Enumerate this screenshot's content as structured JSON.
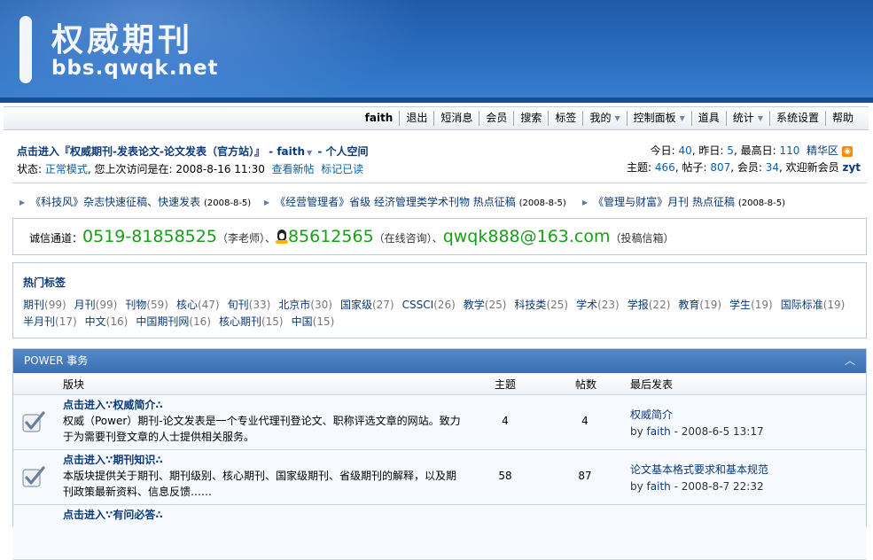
{
  "banner": {
    "title": "权威期刊",
    "url": "bbs.qwqk.net"
  },
  "nav": [
    {
      "label": "faith"
    },
    {
      "label": "退出"
    },
    {
      "label": "短消息"
    },
    {
      "label": "会员"
    },
    {
      "label": "搜索"
    },
    {
      "label": "标签"
    },
    {
      "label": "我的",
      "dropdown": true
    },
    {
      "label": "控制面板",
      "dropdown": true
    },
    {
      "label": "道具"
    },
    {
      "label": "统计",
      "dropdown": true
    },
    {
      "label": "系统设置"
    },
    {
      "label": "帮助"
    }
  ],
  "info": {
    "enter_link": "点击进入『权威期刊-发表论文-论文发表（官方站）』",
    "sep": " - ",
    "user": "faith",
    "space": "- 个人空间",
    "status_label": "状态: ",
    "status_mode": "正常模式",
    "status_text": ", 您上次访问是在: 2008-8-16 11:30",
    "view_new": "查看新帖",
    "mark_read": "标记已读"
  },
  "stats": {
    "today_label": "今日: ",
    "today": "40",
    "yesterday_label": ", 昨日: ",
    "yesterday": "5",
    "max_label": ", 最高日: ",
    "max": "110",
    "digest": "精华区",
    "topics_label": "主题: ",
    "topics": "466",
    "posts_label": ", 帖子: ",
    "posts": "807",
    "members_label": ", 会员: ",
    "members": "34",
    "welcome_label": ", 欢迎新会员 ",
    "newest": "zyt"
  },
  "notices": [
    {
      "text": "《科技风》杂志快速征稿、快速发表",
      "date": "(2008-8-5)"
    },
    {
      "text": "《经营管理者》省级 经济管理类学术刊物 热点征稿",
      "date": "(2008-8-5)"
    },
    {
      "text": "《管理与财富》月刊 热点征稿",
      "date": "(2008-8-5)"
    }
  ],
  "hotline": {
    "label": "诚信通道：",
    "phone": "0519-81858525",
    "phone_note": "（李老师）、",
    "qq": "85612565",
    "qq_note": "（在线咨询）、",
    "email": "qwqk888@163.com",
    "email_note": "（投稿信箱）"
  },
  "tags": {
    "title": "热门标签",
    "row1": [
      {
        "name": "期刊",
        "count": "(99)"
      },
      {
        "name": "月刊",
        "count": "(99)"
      },
      {
        "name": "刊物",
        "count": "(59)"
      },
      {
        "name": "核心",
        "count": "(47)"
      },
      {
        "name": "旬刊",
        "count": "(33)"
      },
      {
        "name": "北京市",
        "count": "(30)"
      },
      {
        "name": "国家级",
        "count": "(27)"
      },
      {
        "name": "CSSCI",
        "count": "(26)"
      },
      {
        "name": "教学",
        "count": "(25)"
      },
      {
        "name": "科技类",
        "count": "(25)"
      },
      {
        "name": "学术",
        "count": "(23)"
      },
      {
        "name": "学报",
        "count": "(22)"
      },
      {
        "name": "教育",
        "count": "(19)"
      },
      {
        "name": "学生",
        "count": "(19)"
      },
      {
        "name": "国际标准",
        "count": "(19)"
      }
    ],
    "row2": [
      {
        "name": "半月刊",
        "count": "(17)"
      },
      {
        "name": "中文",
        "count": "(16)"
      },
      {
        "name": "中国期刊网",
        "count": "(16)"
      },
      {
        "name": "核心期刊",
        "count": "(15)"
      },
      {
        "name": "中国",
        "count": "(15)"
      }
    ]
  },
  "forum": {
    "section_title": "POWER 事务",
    "collapse": "︿",
    "columns": {
      "board": "版块",
      "topics": "主题",
      "posts": "帖数",
      "last": "最后发表"
    },
    "boards": [
      {
        "name": "点击进入∵权威简介∴",
        "desc": "权威（Power）期刊-论文发表是一个专业代理刊登论文、职称评选文章的网站。致力于为需要刊登文章的人士提供相关服务。",
        "topics": "4",
        "posts": "4",
        "last_title": "权威简介",
        "last_by": "by ",
        "last_user": "faith",
        "last_time": " - 2008-6-5 13:17"
      },
      {
        "name": "点击进入∵期刊知识∴",
        "desc": "本版块提供关于期刊、期刊级别、核心期刊、国家级期刊、省级期刊的解释，以及期刊政策最新资料、信息反馈……",
        "topics": "58",
        "posts": "87",
        "last_title": "论文基本格式要求和基本规范",
        "last_by": "by ",
        "last_user": "faith",
        "last_time": " - 2008-8-7 22:32"
      },
      {
        "name": "点击进入∵有问必答∴",
        "desc": "",
        "topics": "",
        "posts": "",
        "last_title": "",
        "last_by": "",
        "last_user": "",
        "last_time": ""
      }
    ]
  }
}
